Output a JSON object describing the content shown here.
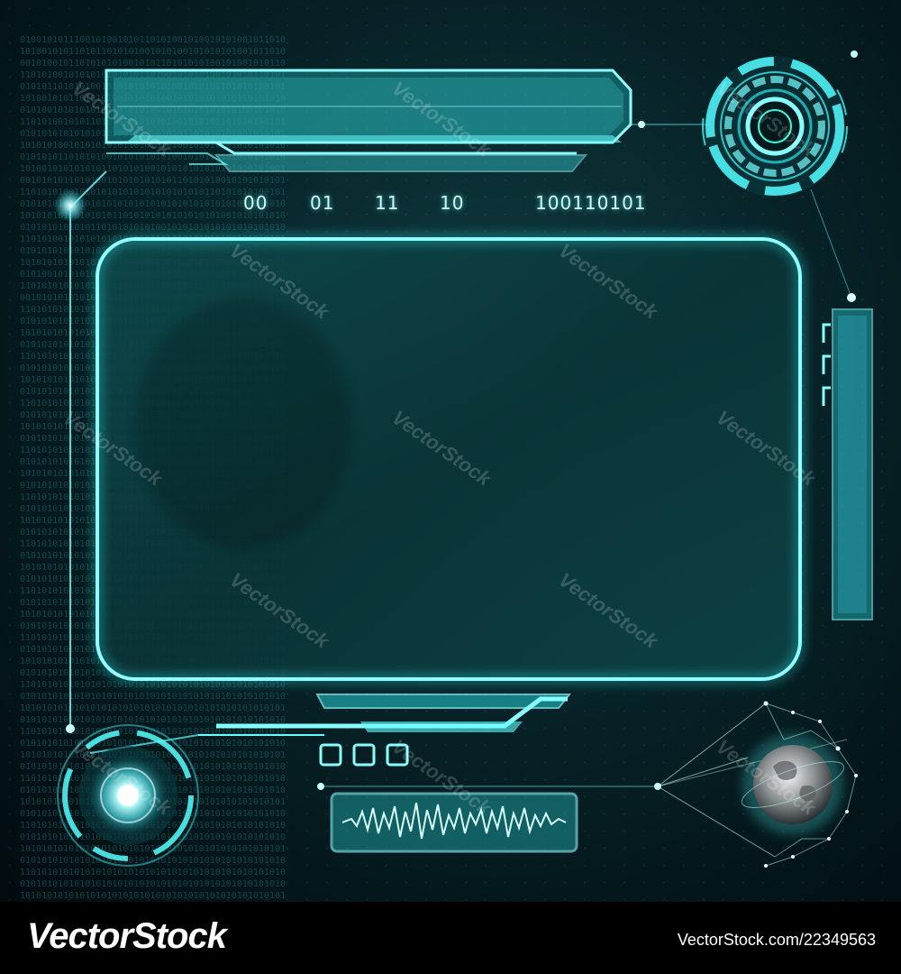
{
  "top_bits": {
    "b1": "00",
    "b2": "01",
    "b3": "11",
    "b4": "10",
    "b5": "100110101"
  },
  "watermark": {
    "text": "VectorStock",
    "footer_logo": "VectorStock",
    "footer_url": "VectorStock.com/22349563"
  },
  "colors": {
    "accent": "#5ff0f0",
    "panel_border": "#7dfbff",
    "background": "#062227"
  },
  "icons": [
    "radar-dial-icon",
    "power-orb-icon",
    "globe-icon",
    "waveform-icon",
    "square-button-icon"
  ]
}
